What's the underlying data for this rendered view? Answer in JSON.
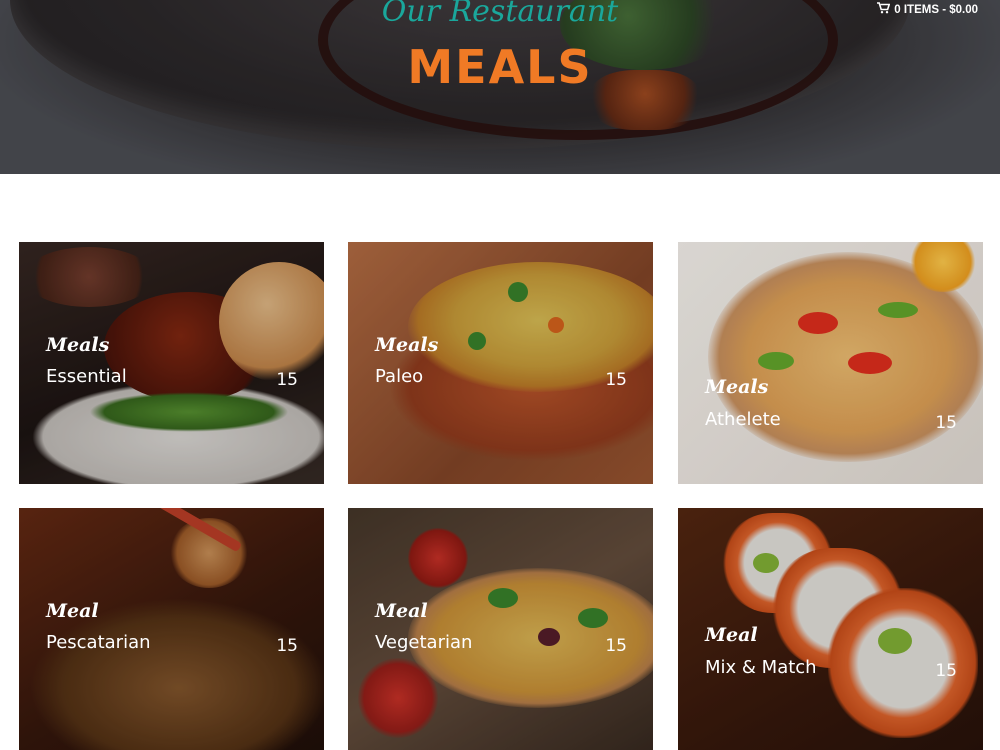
{
  "hero": {
    "subtitle": "Our Restaurant",
    "title": "MEALS"
  },
  "cart": {
    "icon": "shopping-cart-icon",
    "label": "0 ITEMS - $0.00"
  },
  "meals": [
    {
      "tag": "Meals",
      "name": "Essential",
      "count": "15"
    },
    {
      "tag": "Meals",
      "name": "Paleo",
      "count": "15"
    },
    {
      "tag": "Meals",
      "name": "Athelete",
      "count": "15"
    },
    {
      "tag": "Meal",
      "name": "Pescatarian",
      "count": "15"
    },
    {
      "tag": "Meal",
      "name": "Vegetarian",
      "count": "15"
    },
    {
      "tag": "Meal",
      "name": "Mix & Match",
      "count": "15"
    }
  ],
  "colors": {
    "accent_orange": "#f07a25",
    "accent_teal": "#1aa79b"
  }
}
